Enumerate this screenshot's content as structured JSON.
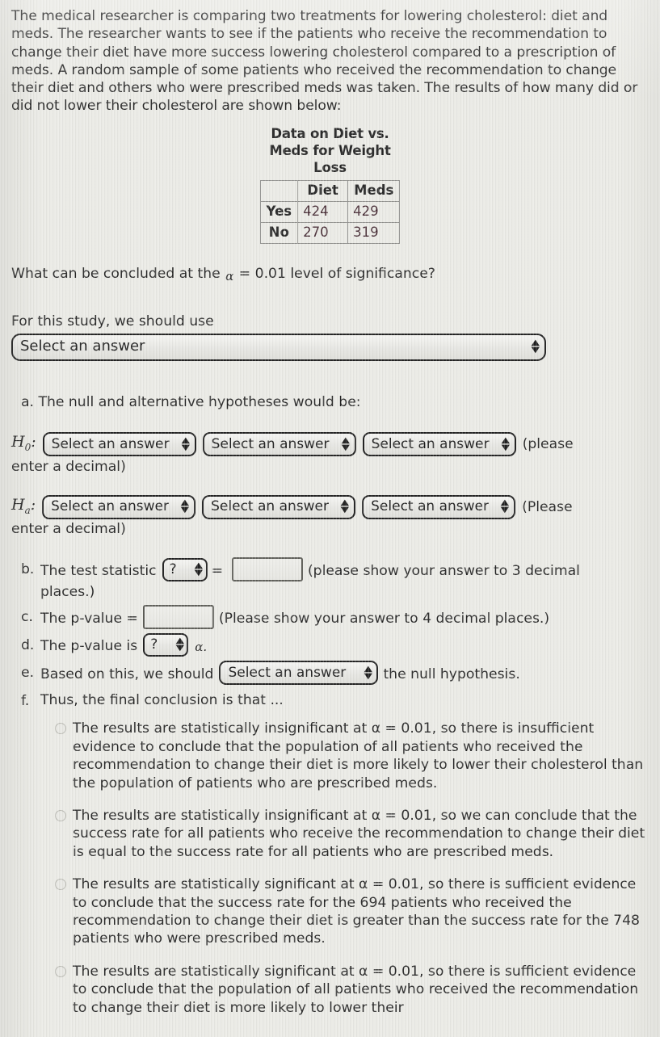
{
  "intro": {
    "paragraph": "The medical researcher is comparing two treatments for lowering cholesterol:  diet and meds.  The researcher wants to see if the patients who receive the recommendation to change their diet have more success lowering cholesterol compared to a prescription of meds.  A random sample of some patients who received the recommendation to change their diet and others who were prescribed meds was taken.  The results of how many did or did not lower their cholesterol are shown below:"
  },
  "table": {
    "title": "Data on Diet vs. Meds for Weight Loss",
    "corner": "",
    "columns": [
      "Diet",
      "Meds"
    ],
    "rows": [
      {
        "label": "Yes",
        "diet": "424",
        "meds": "429"
      },
      {
        "label": "No",
        "diet": "270",
        "meds": "319"
      }
    ]
  },
  "question": {
    "prefix": "What can be concluded at the",
    "alpha": "α",
    "alpha_value": "= 0.01",
    "suffix": "level of significance?"
  },
  "study": {
    "label": "For this study, we should use",
    "select_value": "Select an answer"
  },
  "part_a": {
    "marker": "a.",
    "text": "The null and alternative hypotheses would be:",
    "null_symbol": "H",
    "null_sub": "0",
    "alt_symbol": "H",
    "alt_sub": "a",
    "colon": ":",
    "select_value": "Select an answer",
    "null_trail": "(please",
    "null_trail2": "enter a decimal)",
    "alt_trail": "(Please",
    "alt_trail2": "enter a decimal)"
  },
  "part_b": {
    "marker": "b.",
    "text": "The test statistic",
    "select_value": "?",
    "equals": "=",
    "input_value": "",
    "trail": "(please show your answer to 3 decimal",
    "trail2": "places.)"
  },
  "part_c": {
    "marker": "c.",
    "text": "The p-value =",
    "input_value": "",
    "trail": "(Please show your answer to 4 decimal places.)"
  },
  "part_d": {
    "marker": "d.",
    "text": "The p-value is",
    "select_value": "?",
    "alpha": "α."
  },
  "part_e": {
    "marker": "e.",
    "text": "Based on this, we should",
    "select_value": "Select an answer",
    "trail": "the null hypothesis."
  },
  "part_f": {
    "marker": "f.",
    "text": "Thus, the final conclusion is that ...",
    "options": [
      "The results are statistically insignificant at α = 0.01, so there is insufficient evidence to conclude that the population of all patients who received the recommendation to change their diet is more likely to lower their cholesterol than the population of patients who are prescribed meds.",
      "The results are statistically insignificant at α = 0.01, so we can conclude that the success rate for all patients who receive the recommendation to change their diet is equal to the success rate for all patients who are prescribed meds.",
      "The results are statistically significant at α = 0.01, so there is sufficient evidence to conclude that the success rate for the 694 patients who received the recommendation to change their diet is greater than the success rate for the 748 patients who were prescribed meds.",
      "The results are statistically significant at α = 0.01, so there is sufficient evidence to conclude that the population of all patients who received the recommendation to change their diet is more likely to lower their"
    ]
  },
  "icons": {
    "select_up_arrow": "▲",
    "select_down_arrow": "▼"
  },
  "colors": {
    "background": "#e9e9e4",
    "text": "#1b1b1b",
    "table_value": "#3b1f28",
    "control_border": "#141414"
  }
}
